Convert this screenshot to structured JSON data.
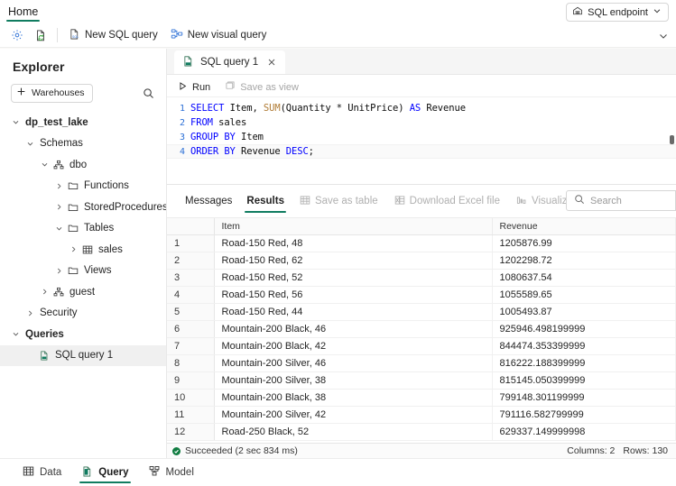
{
  "ribbon": {
    "tabs": [
      {
        "label": "Home",
        "active": true
      }
    ],
    "endpoint_button": {
      "label": "SQL endpoint",
      "icon": "warehouse-icon",
      "chevron": "chevron-down-icon"
    }
  },
  "command_bar": {
    "icon_buttons": [
      {
        "name": "settings-icon",
        "label": "Settings"
      },
      {
        "name": "refresh-file-icon",
        "label": "Refresh"
      }
    ],
    "buttons": [
      {
        "name": "new-sql-query",
        "label": "New SQL query",
        "icon": "sql-file-icon"
      },
      {
        "name": "new-visual-query",
        "label": "New visual query",
        "icon": "visual-query-icon"
      }
    ],
    "expand_chevron": "chevron-down-icon"
  },
  "explorer": {
    "title": "Explorer",
    "warehouses_button": "Warehouses",
    "search_icon": "search-icon",
    "tree": [
      {
        "label": "dp_test_lake",
        "indent": 0,
        "state": "expanded",
        "icon": "none",
        "bold": true
      },
      {
        "label": "Schemas",
        "indent": 1,
        "state": "expanded",
        "icon": "none",
        "bold": false
      },
      {
        "label": "dbo",
        "indent": 2,
        "state": "expanded",
        "icon": "schema-icon",
        "bold": false
      },
      {
        "label": "Functions",
        "indent": 3,
        "state": "collapsed",
        "icon": "folder-icon",
        "bold": false
      },
      {
        "label": "StoredProcedures",
        "indent": 3,
        "state": "collapsed",
        "icon": "folder-icon",
        "bold": false
      },
      {
        "label": "Tables",
        "indent": 3,
        "state": "expanded",
        "icon": "folder-icon",
        "bold": false
      },
      {
        "label": "sales",
        "indent": 4,
        "state": "collapsed",
        "icon": "table-icon",
        "bold": false
      },
      {
        "label": "Views",
        "indent": 3,
        "state": "collapsed",
        "icon": "folder-icon",
        "bold": false
      },
      {
        "label": "guest",
        "indent": 2,
        "state": "collapsed",
        "icon": "schema-icon",
        "bold": false
      },
      {
        "label": "Security",
        "indent": 1,
        "state": "collapsed",
        "icon": "none",
        "bold": false
      },
      {
        "label": "Queries",
        "indent": 0,
        "state": "expanded",
        "icon": "none",
        "bold": true
      },
      {
        "label": "SQL query 1",
        "indent": 1,
        "state": "none",
        "icon": "sql-file-icon",
        "bold": false,
        "selected": true
      }
    ]
  },
  "editor": {
    "doc_tab": {
      "label": "SQL query 1",
      "icon": "sql-file-icon",
      "close_icon": "close-icon"
    },
    "toolbar": [
      {
        "name": "run-button",
        "label": "Run",
        "icon": "play-icon",
        "disabled": false
      },
      {
        "name": "save-as-view-button",
        "label": "Save as view",
        "icon": "save-view-icon",
        "disabled": true
      }
    ],
    "code_lines": [
      {
        "n": "1",
        "tokens": [
          {
            "t": "SELECT",
            "c": "kw"
          },
          {
            "t": " Item, ",
            "c": "plain"
          },
          {
            "t": "SUM",
            "c": "fn"
          },
          {
            "t": "(Quantity * UnitPrice) ",
            "c": "plain"
          },
          {
            "t": "AS",
            "c": "kw"
          },
          {
            "t": " Revenue",
            "c": "plain"
          }
        ]
      },
      {
        "n": "2",
        "tokens": [
          {
            "t": "FROM",
            "c": "kw"
          },
          {
            "t": " sales",
            "c": "plain"
          }
        ]
      },
      {
        "n": "3",
        "tokens": [
          {
            "t": "GROUP BY",
            "c": "kw"
          },
          {
            "t": " Item",
            "c": "plain"
          }
        ]
      },
      {
        "n": "4",
        "tokens": [
          {
            "t": "ORDER BY",
            "c": "kw"
          },
          {
            "t": " Revenue ",
            "c": "plain"
          },
          {
            "t": "DESC",
            "c": "kw"
          },
          {
            "t": ";",
            "c": "plain"
          }
        ]
      }
    ],
    "code_plain": "SELECT Item, SUM(Quantity * UnitPrice) AS Revenue\nFROM sales\nGROUP BY Item\nORDER BY Revenue DESC;"
  },
  "results": {
    "tabs": [
      {
        "label": "Messages",
        "active": false
      },
      {
        "label": "Results",
        "active": true
      }
    ],
    "actions": [
      {
        "name": "save-as-table-button",
        "label": "Save as table",
        "icon": "table-icon"
      },
      {
        "name": "download-excel-button",
        "label": "Download Excel file",
        "icon": "excel-icon"
      },
      {
        "name": "visualize-results-button",
        "label": "Visualize results",
        "icon": "chart-icon"
      }
    ],
    "search_placeholder": "Search",
    "search_value": "",
    "columns": [
      "",
      "Item",
      "Revenue"
    ],
    "rows": [
      {
        "n": "1",
        "item": "Road-150 Red, 48",
        "revenue": "1205876.99"
      },
      {
        "n": "2",
        "item": "Road-150 Red, 62",
        "revenue": "1202298.72"
      },
      {
        "n": "3",
        "item": "Road-150 Red, 52",
        "revenue": "1080637.54"
      },
      {
        "n": "4",
        "item": "Road-150 Red, 56",
        "revenue": "1055589.65"
      },
      {
        "n": "5",
        "item": "Road-150 Red, 44",
        "revenue": "1005493.87"
      },
      {
        "n": "6",
        "item": "Mountain-200 Black, 46",
        "revenue": "925946.498199999"
      },
      {
        "n": "7",
        "item": "Mountain-200 Black, 42",
        "revenue": "844474.353399999"
      },
      {
        "n": "8",
        "item": "Mountain-200 Silver, 46",
        "revenue": "816222.188399999"
      },
      {
        "n": "9",
        "item": "Mountain-200 Silver, 38",
        "revenue": "815145.050399999"
      },
      {
        "n": "10",
        "item": "Mountain-200 Black, 38",
        "revenue": "799148.301199999"
      },
      {
        "n": "11",
        "item": "Mountain-200 Silver, 42",
        "revenue": "791116.582799999"
      },
      {
        "n": "12",
        "item": "Road-250 Black, 52",
        "revenue": "629337.149999998"
      }
    ],
    "status": {
      "message": "Succeeded (2 sec 834 ms)",
      "columns_label": "Columns: 2",
      "rows_label": "Rows: 130"
    }
  },
  "mode_bar": [
    {
      "label": "Data",
      "icon": "table-icon",
      "active": false
    },
    {
      "label": "Query",
      "icon": "query-icon",
      "active": true
    },
    {
      "label": "Model",
      "icon": "model-icon",
      "active": false
    }
  ],
  "colors": {
    "accent": "#107c60",
    "keyword": "#0000ff",
    "function": "#b07b35",
    "line_number": "#2b6fd6",
    "success": "#107c41"
  }
}
